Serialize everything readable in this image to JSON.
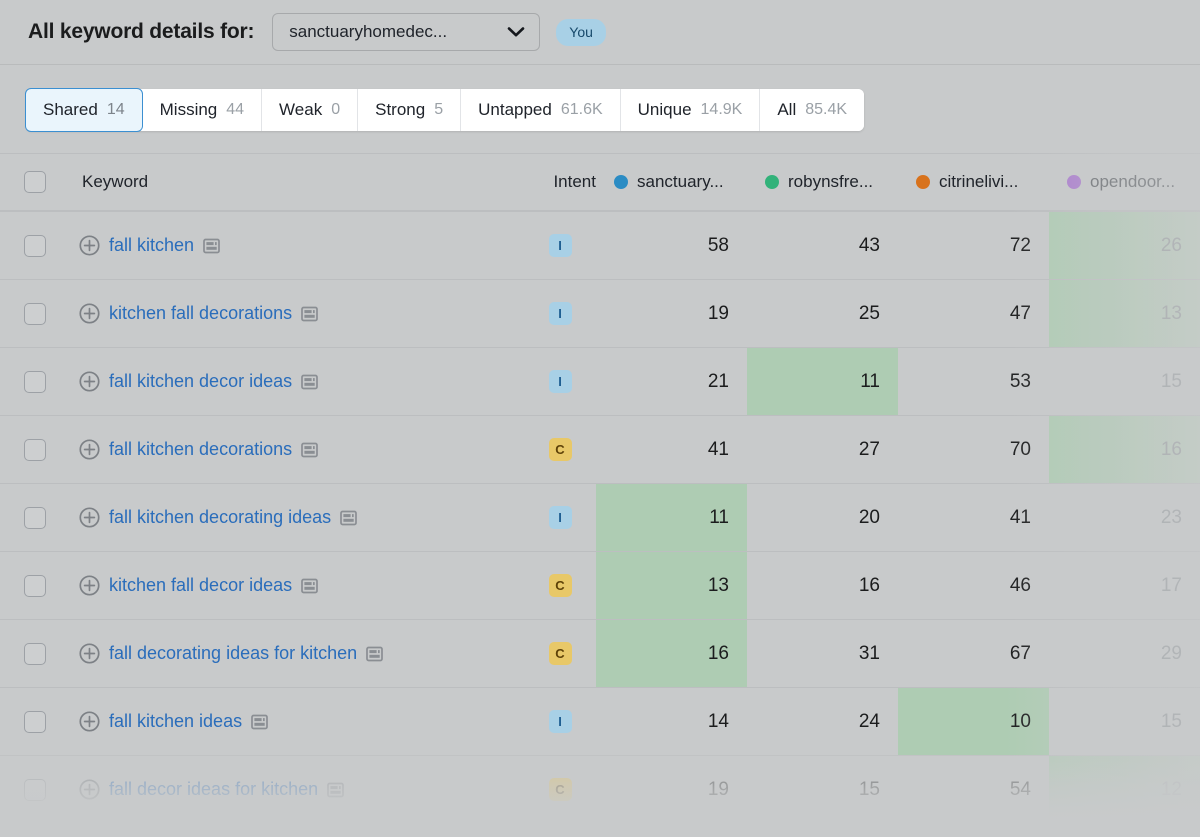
{
  "header": {
    "title": "All keyword details for:",
    "site_select": {
      "value": "sanctuaryhomedec...",
      "icon": "chevron-down-icon"
    },
    "you_badge": "You"
  },
  "tabs": [
    {
      "label": "Shared",
      "count": "14",
      "active": true
    },
    {
      "label": "Missing",
      "count": "44",
      "active": false
    },
    {
      "label": "Weak",
      "count": "0",
      "active": false
    },
    {
      "label": "Strong",
      "count": "5",
      "active": false
    },
    {
      "label": "Untapped",
      "count": "61.6K",
      "active": false
    },
    {
      "label": "Unique",
      "count": "14.9K",
      "active": false
    },
    {
      "label": "All",
      "count": "85.4K",
      "active": false
    }
  ],
  "table": {
    "columns": {
      "keyword": "Keyword",
      "intent": "Intent",
      "domains": [
        {
          "name": "sanctuary...",
          "color": "#2b8cc4"
        },
        {
          "name": "robynsfre...",
          "color": "#32b27a"
        },
        {
          "name": "citrinelivi...",
          "color": "#d8721c"
        },
        {
          "name": "opendoor...",
          "color": "#9b4fd1"
        }
      ]
    },
    "rows": [
      {
        "keyword": "fall kitchen",
        "intent": "I",
        "values": [
          "58",
          "43",
          "72",
          "26"
        ],
        "best_index": 3
      },
      {
        "keyword": "kitchen fall decorations",
        "intent": "I",
        "values": [
          "19",
          "25",
          "47",
          "13"
        ],
        "best_index": 3
      },
      {
        "keyword": "fall kitchen decor ideas",
        "intent": "I",
        "values": [
          "21",
          "11",
          "53",
          "15"
        ],
        "best_index": 1
      },
      {
        "keyword": "fall kitchen decorations",
        "intent": "C",
        "values": [
          "41",
          "27",
          "70",
          "16"
        ],
        "best_index": 3
      },
      {
        "keyword": "fall kitchen decorating ideas",
        "intent": "I",
        "values": [
          "11",
          "20",
          "41",
          "23"
        ],
        "best_index": 0
      },
      {
        "keyword": "kitchen fall decor ideas",
        "intent": "C",
        "values": [
          "13",
          "16",
          "46",
          "17"
        ],
        "best_index": 0
      },
      {
        "keyword": "fall decorating ideas for kitchen",
        "intent": "C",
        "values": [
          "16",
          "31",
          "67",
          "29"
        ],
        "best_index": 0
      },
      {
        "keyword": "fall kitchen ideas",
        "intent": "I",
        "values": [
          "14",
          "24",
          "10",
          "15"
        ],
        "best_index": 2
      },
      {
        "keyword": "fall decor ideas for kitchen",
        "intent": "C",
        "values": [
          "19",
          "15",
          "54",
          "12"
        ],
        "best_index": 3,
        "partial": true
      }
    ]
  },
  "colors": {
    "page_bg": "#c8cacb",
    "accent_blue": "#2a6dbb",
    "highlight_green": "#aeccb3",
    "intent_informational": "#a8d0e6",
    "intent_commercial": "#e8c868"
  }
}
